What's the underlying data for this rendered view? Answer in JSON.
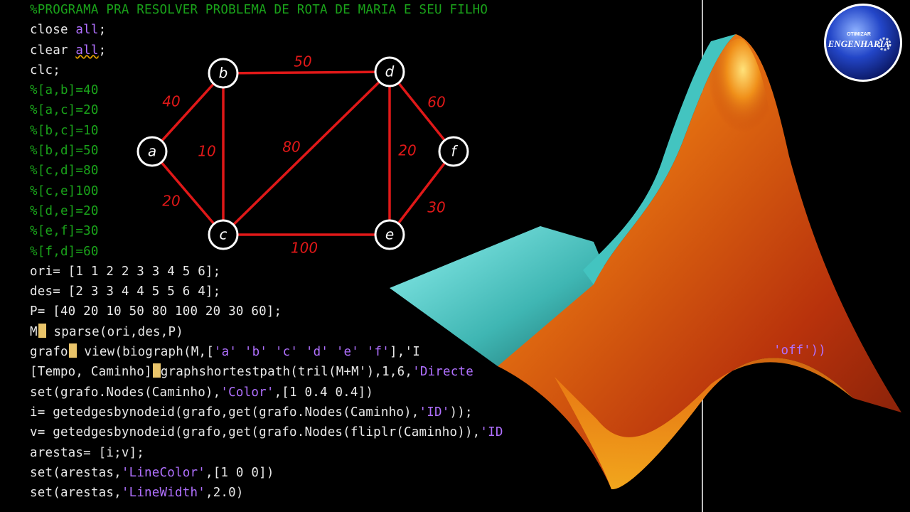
{
  "code_lines": [
    {
      "type": "comment",
      "text": "%PROGRAMA PRA RESOLVER PROBLEMA DE ROTA DE MARIA E SEU FILHO"
    },
    {
      "type": "kwline",
      "pre": "close ",
      "kw": "all",
      "post": ";"
    },
    {
      "type": "kwline",
      "pre": "clear ",
      "kw": "all",
      "post": ";",
      "squiggle": true
    },
    {
      "type": "plain",
      "text": "clc;"
    },
    {
      "type": "comment",
      "text": "%[a,b]=40"
    },
    {
      "type": "comment",
      "text": "%[a,c]=20"
    },
    {
      "type": "comment",
      "text": "%[b,c]=10"
    },
    {
      "type": "comment",
      "text": "%[b,d]=50"
    },
    {
      "type": "comment",
      "text": "%[c,d]=80"
    },
    {
      "type": "comment",
      "text": "%[c,e]100"
    },
    {
      "type": "comment",
      "text": "%[d,e]=20"
    },
    {
      "type": "comment",
      "text": "%[e,f]=30"
    },
    {
      "type": "comment",
      "text": "%[f,d]=60"
    },
    {
      "type": "plain",
      "text": "ori= [1 1 2 2 3 3 4 5 6];"
    },
    {
      "type": "plain",
      "text": "des= [2 3 3 4 4 5 5 6 4];"
    },
    {
      "type": "plain",
      "text": "P= [40 20 10 50 80 100 20 30 60];"
    },
    {
      "type": "cursor",
      "pre": "M",
      "post": " sparse(ori,des,P)"
    },
    {
      "type": "mixed",
      "parts": [
        [
          "t",
          "grafo"
        ],
        [
          "c",
          ""
        ],
        [
          "t",
          " view(biograph(M,["
        ],
        [
          "s",
          "'a'"
        ],
        [
          "t",
          " "
        ],
        [
          "s",
          "'b'"
        ],
        [
          "t",
          " "
        ],
        [
          "s",
          "'c'"
        ],
        [
          "t",
          " "
        ],
        [
          "s",
          "'d'"
        ],
        [
          "t",
          " "
        ],
        [
          "s",
          "'e'"
        ],
        [
          "t",
          " "
        ],
        [
          "s",
          "'f'"
        ],
        [
          "t",
          "],'I"
        ]
      ]
    },
    {
      "type": "mixed",
      "parts": [
        [
          "t",
          "[Tempo, Caminho]"
        ],
        [
          "c",
          ""
        ],
        [
          "t",
          "graphshortestpath(tril(M+M'),1,6,"
        ],
        [
          "s",
          "'Directe"
        ]
      ]
    },
    {
      "type": "mixed",
      "parts": [
        [
          "t",
          "set(grafo.Nodes(Caminho),"
        ],
        [
          "s",
          "'Color'"
        ],
        [
          "t",
          ",[1 0.4 0.4])"
        ]
      ]
    },
    {
      "type": "mixed",
      "parts": [
        [
          "t",
          "i= getedgesbynodeid(grafo,get(grafo.Nodes(Caminho),"
        ],
        [
          "s",
          "'ID'"
        ],
        [
          "t",
          "));"
        ]
      ]
    },
    {
      "type": "mixed",
      "parts": [
        [
          "t",
          "v= getedgesbynodeid(grafo,get(grafo.Nodes(fliplr(Caminho)),"
        ],
        [
          "s",
          "'ID"
        ]
      ]
    },
    {
      "type": "plain",
      "text": "arestas= [i;v];"
    },
    {
      "type": "mixed",
      "parts": [
        [
          "t",
          "set(arestas,"
        ],
        [
          "s",
          "'LineColor'"
        ],
        [
          "t",
          ",[1 0 0])"
        ]
      ]
    },
    {
      "type": "mixed",
      "parts": [
        [
          "t",
          "set(arestas,"
        ],
        [
          "s",
          "'LineWidth'"
        ],
        [
          "t",
          ",2.0)"
        ]
      ]
    }
  ],
  "peek_text": "'off'))",
  "graph": {
    "nodes": [
      {
        "id": "a",
        "label": "a"
      },
      {
        "id": "b",
        "label": "b"
      },
      {
        "id": "c",
        "label": "c"
      },
      {
        "id": "d",
        "label": "d"
      },
      {
        "id": "e",
        "label": "e"
      },
      {
        "id": "f",
        "label": "f"
      }
    ],
    "edges": [
      {
        "from": "a",
        "to": "b",
        "weight": "40"
      },
      {
        "from": "a",
        "to": "c",
        "weight": "20"
      },
      {
        "from": "b",
        "to": "c",
        "weight": "10"
      },
      {
        "from": "b",
        "to": "d",
        "weight": "50"
      },
      {
        "from": "c",
        "to": "d",
        "weight": "80"
      },
      {
        "from": "c",
        "to": "e",
        "weight": "100"
      },
      {
        "from": "d",
        "to": "e",
        "weight": "20"
      },
      {
        "from": "e",
        "to": "f",
        "weight": "30"
      },
      {
        "from": "d",
        "to": "f",
        "weight": "60"
      }
    ]
  },
  "logo": {
    "top_text": "OTIMIZAR",
    "main_text": "ENGENHARIA"
  },
  "colors": {
    "comment": "#1aa31a",
    "string": "#b070ff",
    "edge": "#e01818",
    "weight": "#e01818"
  }
}
